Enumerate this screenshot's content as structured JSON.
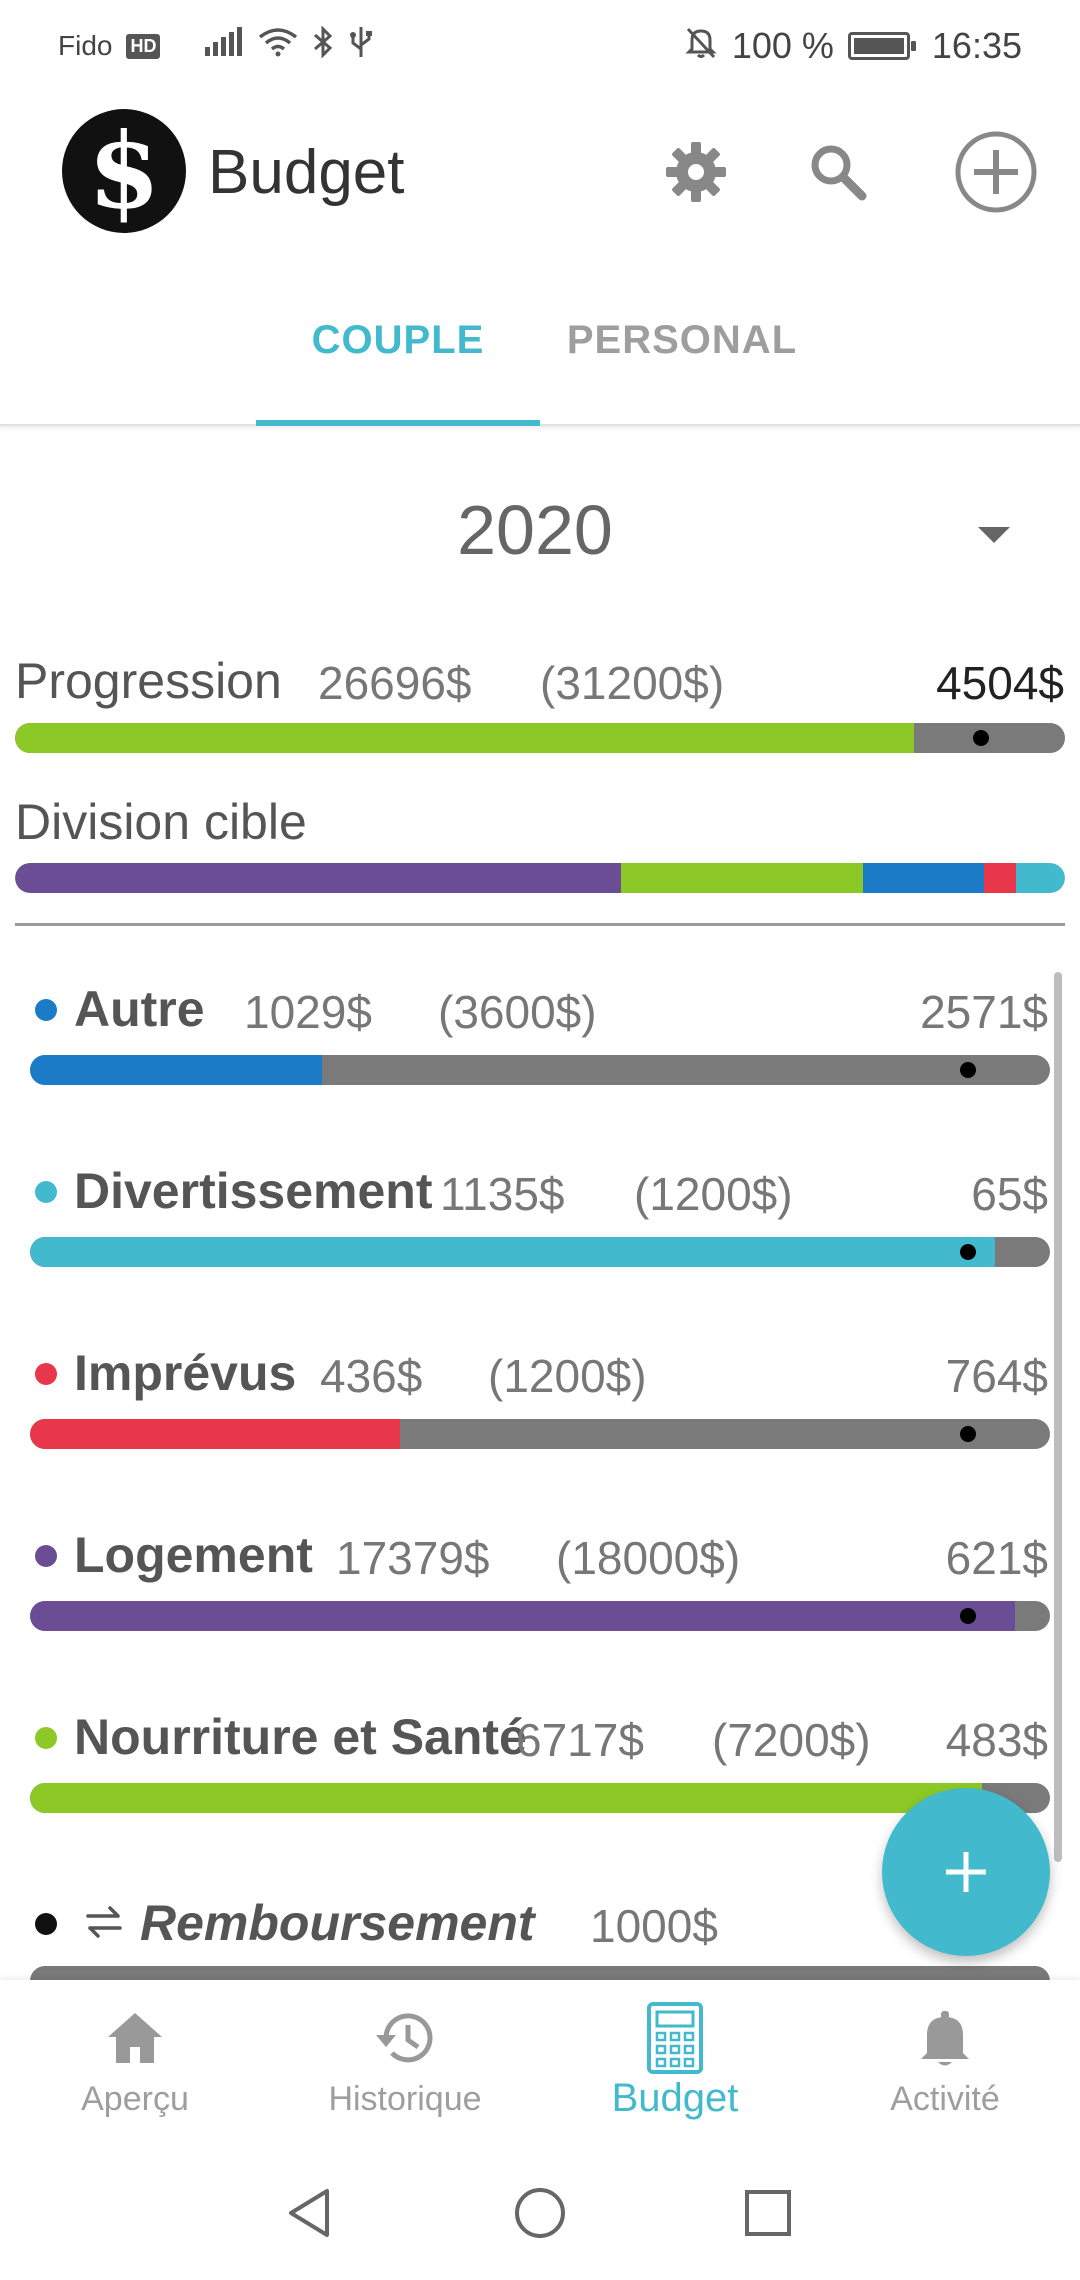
{
  "status_bar": {
    "carrier": "Fido",
    "network_badge": "HD",
    "battery_text": "100 %",
    "time": "16:35",
    "icons": [
      "signal-icon",
      "wifi-icon",
      "bluetooth-icon",
      "usb-icon",
      "mute-icon",
      "battery-icon"
    ]
  },
  "app_bar": {
    "title": "Budget",
    "logo_glyph": "$",
    "icons": [
      "settings-icon",
      "search-icon",
      "add-circle-icon"
    ]
  },
  "tabs": [
    {
      "label": "COUPLE",
      "active": true
    },
    {
      "label": "PERSONAL",
      "active": false
    }
  ],
  "year": "2020",
  "progression": {
    "label": "Progression",
    "spent": "26696$",
    "target": "(31200$)",
    "remaining": "4504$",
    "fill_fraction": 0.856,
    "marker_fraction": 0.92,
    "color": "#8dc926"
  },
  "division_cible": {
    "label": "Division cible",
    "segments": [
      {
        "name": "Logement",
        "fraction": 0.577,
        "color": "#6a4d95"
      },
      {
        "name": "Nourriture et Santé",
        "fraction": 0.231,
        "color": "#8dc926"
      },
      {
        "name": "Autre",
        "fraction": 0.115,
        "color": "#1b7bc6"
      },
      {
        "name": "Imprévus",
        "fraction": 0.03,
        "color": "#e8364a"
      },
      {
        "name": "Divertissement",
        "fraction": 0.047,
        "color": "#42b9cc"
      }
    ]
  },
  "categories": [
    {
      "name": "Autre",
      "spent": "1029$",
      "target": "(3600$)",
      "remaining": "2571$",
      "fill_fraction": 0.286,
      "marker_fraction": 0.92,
      "color": "#1b7bc6"
    },
    {
      "name": "Divertissement",
      "spent": "1135$",
      "target": "(1200$)",
      "remaining": "65$",
      "fill_fraction": 0.946,
      "marker_fraction": 0.92,
      "color": "#42b9cc"
    },
    {
      "name": "Imprévus",
      "spent": "436$",
      "target": "(1200$)",
      "remaining": "764$",
      "fill_fraction": 0.363,
      "marker_fraction": 0.92,
      "color": "#e8364a"
    },
    {
      "name": "Logement",
      "spent": "17379$",
      "target": "(18000$)",
      "remaining": "621$",
      "fill_fraction": 0.966,
      "marker_fraction": 0.92,
      "color": "#6a4d95"
    },
    {
      "name": "Nourriture et Santé",
      "spent": "6717$",
      "target": "(7200$)",
      "remaining": "483$",
      "fill_fraction": 0.933,
      "marker_fraction": 0.92,
      "color": "#8dc926"
    }
  ],
  "remboursement": {
    "name": "Remboursement",
    "amount": "1000$",
    "color": "#111111",
    "icon": "swap-arrows-icon"
  },
  "fab": {
    "icon": "plus-icon"
  },
  "bottom_nav": [
    {
      "label": "Aperçu",
      "icon": "home-icon",
      "active": false
    },
    {
      "label": "Historique",
      "icon": "history-icon",
      "active": false
    },
    {
      "label": "Budget",
      "icon": "calculator-icon",
      "active": true
    },
    {
      "label": "Activité",
      "icon": "bell-icon",
      "active": false
    }
  ],
  "system_nav": [
    "back-icon",
    "home-circle-icon",
    "recents-icon"
  ],
  "colors": {
    "accent": "#42b9cc",
    "track": "#7a7a7a",
    "inactive": "#9e9e9e"
  }
}
